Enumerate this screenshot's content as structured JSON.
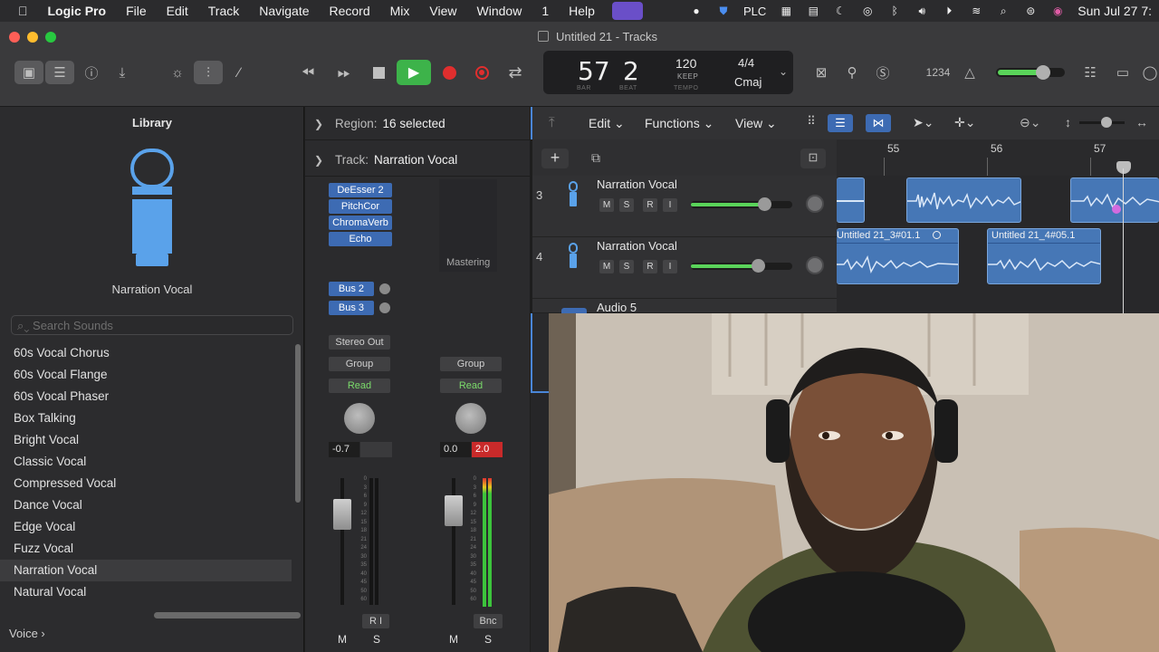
{
  "menubar": {
    "app_name": "Logic Pro",
    "items": [
      "File",
      "Edit",
      "Track",
      "Navigate",
      "Record",
      "Mix",
      "View",
      "Window",
      "1",
      "Help"
    ],
    "plc_label": "PLC",
    "datetime": "Sun Jul 27  7:"
  },
  "window": {
    "title": "Untitled 21 - Tracks"
  },
  "lcd": {
    "bar": "57",
    "bar_label": "BAR",
    "beat": "2",
    "beat_label": "BEAT",
    "tempo": "120",
    "tempo_mode": "KEEP",
    "tempo_label": "TEMPO",
    "time_sig": "4/4",
    "key": "Cmaj"
  },
  "toolbar": {
    "count_in": "1234"
  },
  "library": {
    "title": "Library",
    "preset_name": "Narration Vocal",
    "search_placeholder": "Search Sounds",
    "items": [
      "60s Vocal Chorus",
      "60s Vocal Flange",
      "60s Vocal Phaser",
      "Box Talking",
      "Bright Vocal",
      "Classic Vocal",
      "Compressed Vocal",
      "Dance Vocal",
      "Edge Vocal",
      "Fuzz Vocal",
      "Narration Vocal",
      "Natural Vocal"
    ],
    "selected_index": 10,
    "footer": "Voice  ›"
  },
  "inspector": {
    "region_label": "Region:",
    "region_value": "16 selected",
    "track_label": "Track:",
    "track_value": "Narration Vocal",
    "plugins": [
      "DeEsser 2",
      "PitchCor",
      "ChromaVerb",
      "Echo"
    ],
    "mastering": "Mastering",
    "sends": [
      "Bus 2",
      "Bus 3"
    ],
    "output": "Stereo Out",
    "group1": "Group",
    "group2": "Group",
    "auto1": "Read",
    "auto2": "Read",
    "vol1": "-0.7",
    "vol2": "0.0",
    "peak2": "2.0",
    "scale": [
      "0",
      "3",
      "6",
      "9",
      "12",
      "15",
      "18",
      "21",
      "24",
      "30",
      "35",
      "40",
      "45",
      "50",
      "60"
    ],
    "ri": "R  I",
    "bnc": "Bnc",
    "m1": "M",
    "s1": "S",
    "m2": "M",
    "s2": "S"
  },
  "tracks_header": {
    "edit": "Edit",
    "functions": "Functions",
    "view": "View",
    "ruler": [
      "55",
      "56",
      "57"
    ]
  },
  "tracks": [
    {
      "num": "3",
      "name": "Narration Vocal",
      "volume_fraction": 0.72
    },
    {
      "num": "4",
      "name": "Narration Vocal",
      "volume_fraction": 0.66
    },
    {
      "num": "5",
      "name": "Audio 5"
    }
  ],
  "track_buttons": [
    "M",
    "S",
    "R",
    "I"
  ],
  "regions": {
    "r1_name": "Untitled 21_3#01.1",
    "r2_name": "Untitled 21_4#05.1"
  }
}
